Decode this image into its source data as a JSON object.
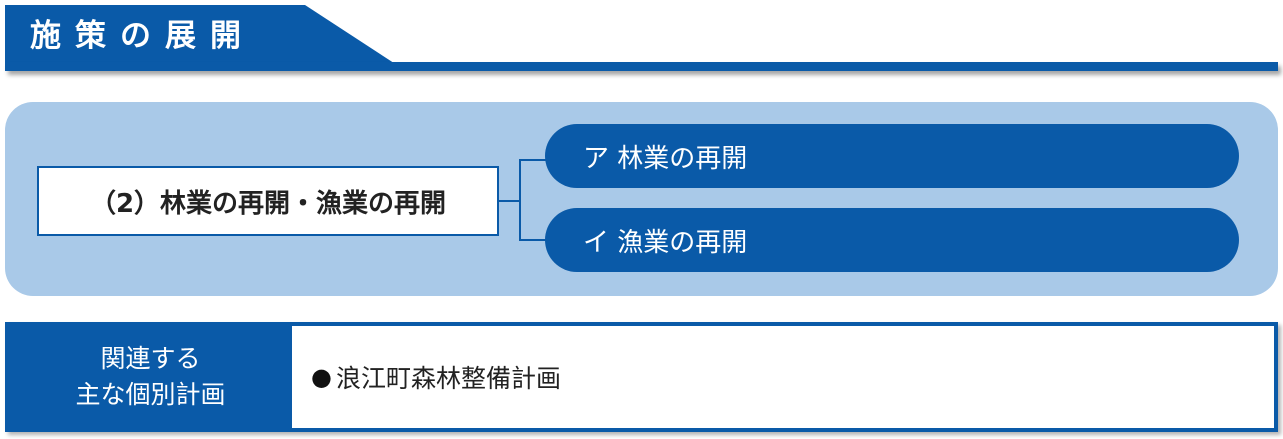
{
  "header": {
    "title": "施策の展開"
  },
  "structure": {
    "root_label": "（2）林業の再開・漁業の再開",
    "branches": [
      {
        "label": "ア 林業の再開"
      },
      {
        "label": "イ 漁業の再開"
      }
    ]
  },
  "related_plans": {
    "heading_line1": "関連する",
    "heading_line2": "主な個別計画",
    "bullet": "●",
    "items": [
      "浪江町森林整備計画"
    ]
  },
  "colors": {
    "primary_blue": "#0a5aa8",
    "panel_blue": "#a9c9e8",
    "white": "#ffffff"
  }
}
